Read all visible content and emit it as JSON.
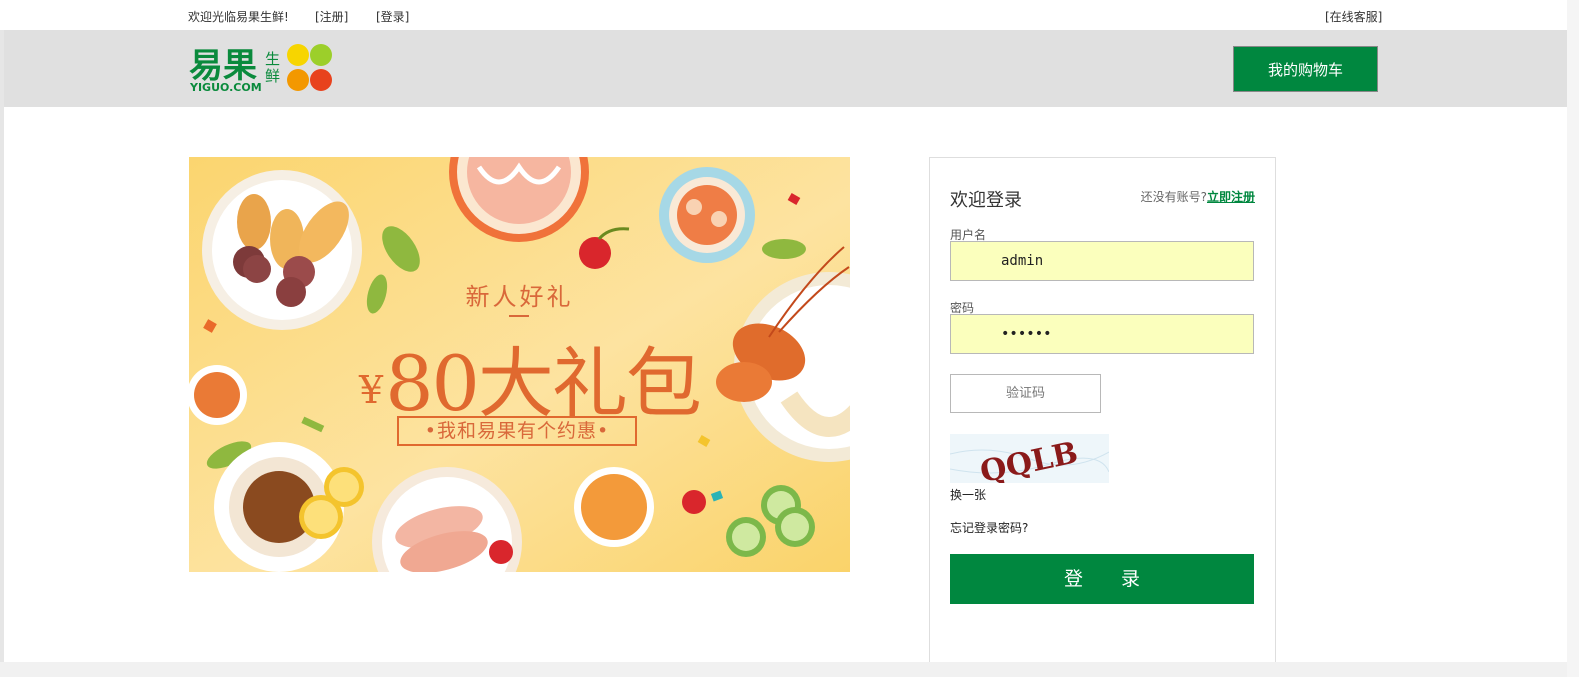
{
  "topbar": {
    "welcome": "欢迎光临易果生鲜!",
    "register": "[注册]",
    "login": "[登录]",
    "service": "[在线客服]"
  },
  "header": {
    "logo_text": "易果",
    "logo_sub": "生鲜",
    "logo_domain": "YIGUO.COM",
    "cart_label": "我的购物车"
  },
  "banner": {
    "line1": "新人好礼",
    "currency": "¥",
    "amount_text": "80大礼包",
    "sub": "•我和易果有个约惠•"
  },
  "login": {
    "title": "欢迎登录",
    "no_account_text": "还没有账号?",
    "register_now": "立即注册",
    "username_label": "用户名",
    "username_value": "admin",
    "password_label": "密码",
    "password_value": "••••••",
    "captcha_placeholder": "验证码",
    "captcha_text": "QQLB",
    "refresh_label": "换一张",
    "forgot_label": "忘记登录密码?",
    "submit_label": "登 录"
  },
  "colors": {
    "brand_green": "#00873f",
    "input_bg": "#fbffbd",
    "banner_bg": "#fbd97a",
    "banner_text": "#e0692f"
  }
}
